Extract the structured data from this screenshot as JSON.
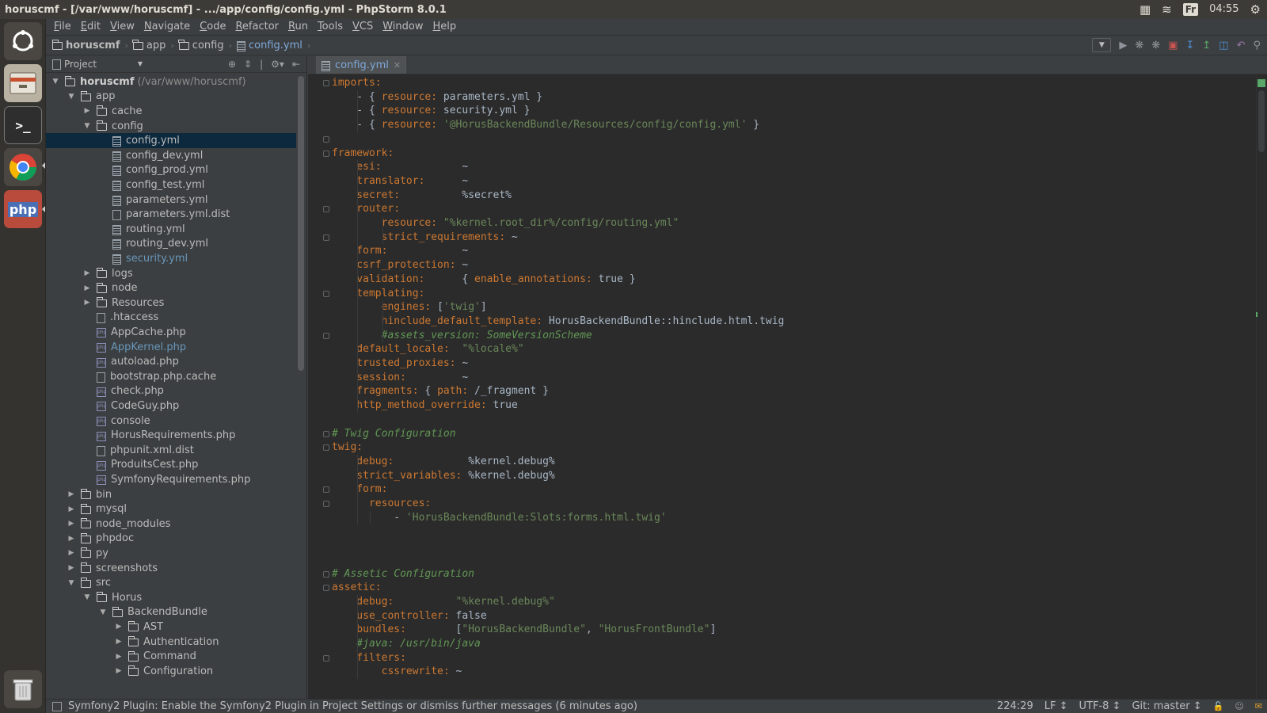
{
  "os": {
    "window_title": "horuscmf - [/var/www/horuscmf] - .../app/config/config.yml - PhpStorm 8.0.1",
    "keyboard_layout": "Fr",
    "clock": "04:55"
  },
  "menu": [
    "File",
    "Edit",
    "View",
    "Navigate",
    "Code",
    "Refactor",
    "Run",
    "Tools",
    "VCS",
    "Window",
    "Help"
  ],
  "breadcrumbs": [
    "horuscmf",
    "app",
    "config",
    "config.yml"
  ],
  "project_panel": {
    "title": "Project",
    "tree": [
      {
        "label": "horuscmf",
        "hint": "(/var/www/horuscmf)"
      },
      {
        "label": "app"
      },
      {
        "label": "cache"
      },
      {
        "label": "config"
      },
      {
        "label": "config.yml"
      },
      {
        "label": "config_dev.yml"
      },
      {
        "label": "config_prod.yml"
      },
      {
        "label": "config_test.yml"
      },
      {
        "label": "parameters.yml"
      },
      {
        "label": "parameters.yml.dist"
      },
      {
        "label": "routing.yml"
      },
      {
        "label": "routing_dev.yml"
      },
      {
        "label": "security.yml"
      },
      {
        "label": "logs"
      },
      {
        "label": "node"
      },
      {
        "label": "Resources"
      },
      {
        "label": ".htaccess"
      },
      {
        "label": "AppCache.php"
      },
      {
        "label": "AppKernel.php"
      },
      {
        "label": "autoload.php"
      },
      {
        "label": "bootstrap.php.cache"
      },
      {
        "label": "check.php"
      },
      {
        "label": "CodeGuy.php"
      },
      {
        "label": "console"
      },
      {
        "label": "HorusRequirements.php"
      },
      {
        "label": "phpunit.xml.dist"
      },
      {
        "label": "ProduitsCest.php"
      },
      {
        "label": "SymfonyRequirements.php"
      },
      {
        "label": "bin"
      },
      {
        "label": "mysql"
      },
      {
        "label": "node_modules"
      },
      {
        "label": "phpdoc"
      },
      {
        "label": "py"
      },
      {
        "label": "screenshots"
      },
      {
        "label": "src"
      },
      {
        "label": "Horus"
      },
      {
        "label": "BackendBundle"
      },
      {
        "label": "AST"
      },
      {
        "label": "Authentication"
      },
      {
        "label": "Command"
      },
      {
        "label": "Configuration"
      }
    ]
  },
  "editor": {
    "tab_label": "config.yml",
    "lines": [
      [
        [
          "k",
          "imports:"
        ]
      ],
      [
        [
          "v",
          "    - { "
        ],
        [
          "k",
          "resource: "
        ],
        [
          "v",
          "parameters.yml }"
        ]
      ],
      [
        [
          "v",
          "    - { "
        ],
        [
          "k",
          "resource: "
        ],
        [
          "v",
          "security.yml }"
        ]
      ],
      [
        [
          "v",
          "    - { "
        ],
        [
          "k",
          "resource: "
        ],
        [
          "s",
          "'@HorusBackendBundle/Resources/config/config.yml'"
        ],
        [
          "v",
          " }"
        ]
      ],
      [
        [
          "v",
          ""
        ]
      ],
      [
        [
          "k",
          "framework:"
        ]
      ],
      [
        [
          "k",
          "    esi:             "
        ],
        [
          "v",
          "~"
        ]
      ],
      [
        [
          "k",
          "    translator:      "
        ],
        [
          "v",
          "~"
        ]
      ],
      [
        [
          "k",
          "    secret:          "
        ],
        [
          "v",
          "%secret%"
        ]
      ],
      [
        [
          "k",
          "    router:"
        ]
      ],
      [
        [
          "k",
          "        resource: "
        ],
        [
          "s",
          "\"%kernel.root_dir%/config/routing.yml\""
        ]
      ],
      [
        [
          "k",
          "        strict_requirements: "
        ],
        [
          "v",
          "~"
        ]
      ],
      [
        [
          "k",
          "    form:            "
        ],
        [
          "v",
          "~"
        ]
      ],
      [
        [
          "k",
          "    csrf_protection: "
        ],
        [
          "v",
          "~"
        ]
      ],
      [
        [
          "k",
          "    validation:      "
        ],
        [
          "v",
          "{ "
        ],
        [
          "k",
          "enable_annotations: "
        ],
        [
          "v",
          "true }"
        ]
      ],
      [
        [
          "k",
          "    templating:"
        ]
      ],
      [
        [
          "k",
          "        engines: "
        ],
        [
          "v",
          "["
        ],
        [
          "s",
          "'twig'"
        ],
        [
          "v",
          "]"
        ]
      ],
      [
        [
          "k",
          "        hinclude_default_template: "
        ],
        [
          "v",
          "HorusBackendBundle::hinclude.html.twig"
        ]
      ],
      [
        [
          "c",
          "        #assets_version: SomeVersionScheme"
        ]
      ],
      [
        [
          "k",
          "    default_locale:  "
        ],
        [
          "s",
          "\"%locale%\""
        ]
      ],
      [
        [
          "k",
          "    trusted_proxies: "
        ],
        [
          "v",
          "~"
        ]
      ],
      [
        [
          "k",
          "    session:         "
        ],
        [
          "v",
          "~"
        ]
      ],
      [
        [
          "k",
          "    fragments: "
        ],
        [
          "v",
          "{ "
        ],
        [
          "k",
          "path: "
        ],
        [
          "v",
          "/_fragment }"
        ]
      ],
      [
        [
          "k",
          "    http_method_override: "
        ],
        [
          "v",
          "true"
        ]
      ],
      [
        [
          "v",
          ""
        ]
      ],
      [
        [
          "c",
          "# Twig Configuration"
        ]
      ],
      [
        [
          "k",
          "twig:"
        ]
      ],
      [
        [
          "k",
          "    debug:            "
        ],
        [
          "v",
          "%kernel.debug%"
        ]
      ],
      [
        [
          "k",
          "    strict_variables: "
        ],
        [
          "v",
          "%kernel.debug%"
        ]
      ],
      [
        [
          "k",
          "    form:"
        ]
      ],
      [
        [
          "k",
          "      resources:"
        ]
      ],
      [
        [
          "v",
          "          - "
        ],
        [
          "s",
          "'HorusBackendBundle:Slots:forms.html.twig'"
        ]
      ],
      [
        [
          "v",
          ""
        ]
      ],
      [
        [
          "v",
          ""
        ]
      ],
      [
        [
          "v",
          ""
        ]
      ],
      [
        [
          "c",
          "# Assetic Configuration"
        ]
      ],
      [
        [
          "k",
          "assetic:"
        ]
      ],
      [
        [
          "k",
          "    debug:          "
        ],
        [
          "s",
          "\"%kernel.debug%\""
        ]
      ],
      [
        [
          "k",
          "    use_controller: "
        ],
        [
          "v",
          "false"
        ]
      ],
      [
        [
          "k",
          "    bundles:        "
        ],
        [
          "v",
          "["
        ],
        [
          "s",
          "\"HorusBackendBundle\""
        ],
        [
          "v",
          ", "
        ],
        [
          "s",
          "\"HorusFrontBundle\""
        ],
        [
          "v",
          "]"
        ]
      ],
      [
        [
          "c",
          "    #java: /usr/bin/java"
        ]
      ],
      [
        [
          "k",
          "    filters:"
        ]
      ],
      [
        [
          "k",
          "        cssrewrite: "
        ],
        [
          "v",
          "~"
        ]
      ]
    ]
  },
  "status": {
    "message": "Symfony2 Plugin: Enable the Symfony2 Plugin in Project Settings or dismiss further messages (6 minutes ago)",
    "position": "224:29",
    "line_sep": "LF ↕",
    "encoding": "UTF-8 ↕",
    "vcs": "Git: master ↕"
  }
}
